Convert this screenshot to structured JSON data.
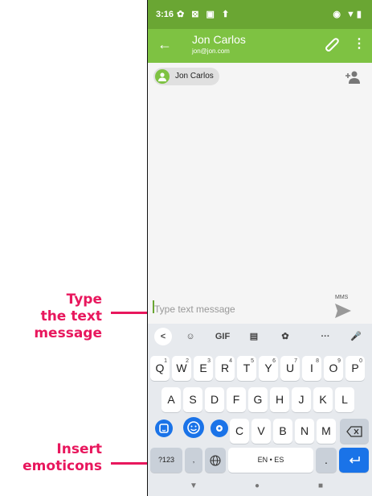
{
  "callouts": {
    "type_message": [
      "Type",
      "the text",
      "message"
    ],
    "insert_emoticons": [
      "Insert",
      "emoticons"
    ]
  },
  "status_bar": {
    "time": "3:16",
    "left_icons": "✿ ⊠ ▣ ⬆",
    "right_icons": "◉ ▼▮"
  },
  "app_bar": {
    "contact_name": "Jon Carlos",
    "contact_email": "jon@jon.com",
    "back_icon": "arrow-left-icon",
    "attach_icon": "paperclip-icon",
    "menu_icon": "more-vert-icon"
  },
  "recipient_chip": {
    "name": "Jon Carlos"
  },
  "compose": {
    "placeholder": "Type text message",
    "mms_label": "MMS"
  },
  "keyboard": {
    "toolbar": [
      "<",
      "☺",
      "GIF",
      "▤",
      "✿",
      "···",
      "🎤"
    ],
    "row1": [
      {
        "key": "Q",
        "num": "1"
      },
      {
        "key": "W",
        "num": "2"
      },
      {
        "key": "E",
        "num": "3"
      },
      {
        "key": "R",
        "num": "4"
      },
      {
        "key": "T",
        "num": "5"
      },
      {
        "key": "Y",
        "num": "6"
      },
      {
        "key": "U",
        "num": "7"
      },
      {
        "key": "I",
        "num": "8"
      },
      {
        "key": "O",
        "num": "9"
      },
      {
        "key": "P",
        "num": "0"
      }
    ],
    "row2": [
      "A",
      "S",
      "D",
      "F",
      "G",
      "H",
      "J",
      "K",
      "L"
    ],
    "row3": [
      "C",
      "V",
      "B",
      "N",
      "M"
    ],
    "symbols_label": "?123",
    "space_label": "EN • ES",
    "period_label": ".",
    "comma_label": ","
  },
  "colors": {
    "accent": "#7ec242",
    "status": "#6aa633",
    "callout": "#e8175d",
    "key_blue": "#1a73e8"
  }
}
